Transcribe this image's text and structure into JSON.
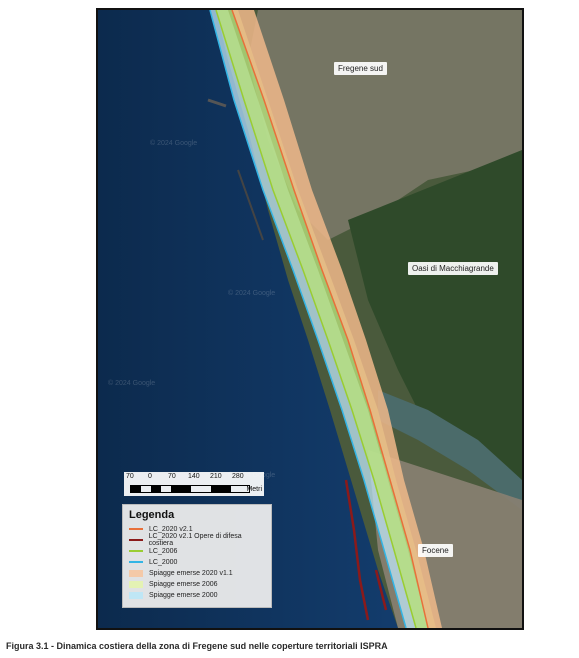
{
  "map": {
    "place_labels": [
      "Fregene sud",
      "Oasi di Macchiagrande",
      "Focene"
    ],
    "watermark": "© 2024 Google",
    "scale": {
      "ticks": [
        "70",
        "0",
        "70",
        "140",
        "210",
        "280"
      ],
      "unit": "Metri"
    }
  },
  "legend": {
    "title": "Legenda",
    "items": [
      {
        "label": "LC_2020 v2.1",
        "kind": "line",
        "color": "#e8703a"
      },
      {
        "label": "LC_2020 v2.1 Opere di difesa costiera",
        "kind": "line",
        "color": "#8b1a1a"
      },
      {
        "label": "LC_2006",
        "kind": "line",
        "color": "#9acd32"
      },
      {
        "label": "LC_2000",
        "kind": "line",
        "color": "#33b5e5"
      },
      {
        "label": "Spiagge emerse 2020 v1.1",
        "kind": "fill",
        "color": "#f4c9a8"
      },
      {
        "label": "Spiagge emerse 2006",
        "kind": "fill",
        "color": "#e4f2b4"
      },
      {
        "label": "Spiagge emerse 2000",
        "kind": "fill",
        "color": "#bfe6f5"
      }
    ]
  },
  "caption": "Figura 3.1 - Dinamica costiera della zona di Fregene sud nelle coperture territoriali ISPRA"
}
